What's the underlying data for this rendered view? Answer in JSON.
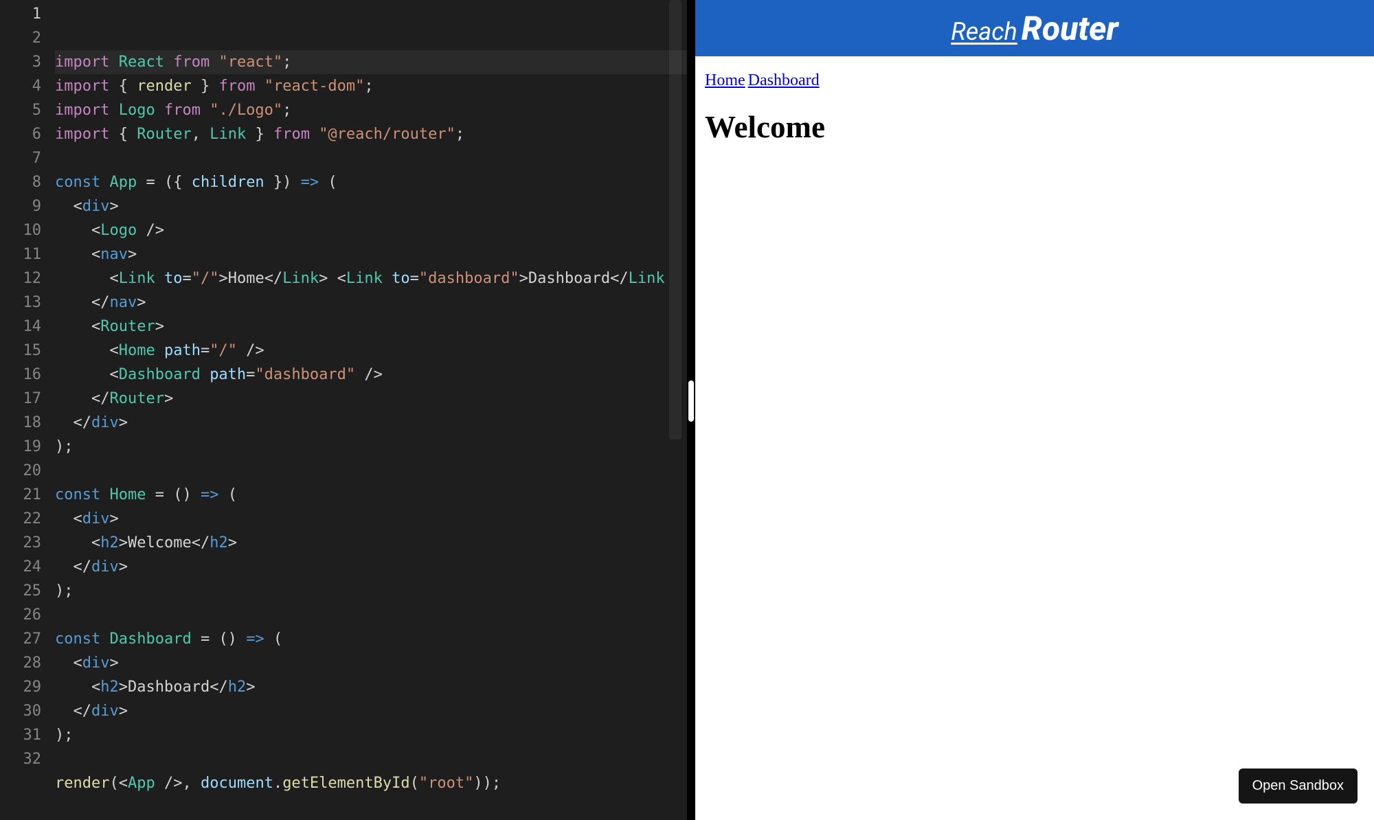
{
  "editor": {
    "line_count": 32,
    "current_line": 1,
    "lines": [
      {
        "n": 1,
        "tokens": [
          [
            "k",
            "import"
          ],
          [
            "punc",
            " "
          ],
          [
            "cls",
            "React"
          ],
          [
            "punc",
            " "
          ],
          [
            "k",
            "from"
          ],
          [
            "punc",
            " "
          ],
          [
            "str",
            "\"react\""
          ],
          [
            "punc",
            ";"
          ]
        ]
      },
      {
        "n": 2,
        "tokens": [
          [
            "k",
            "import"
          ],
          [
            "punc",
            " { "
          ],
          [
            "fn",
            "render"
          ],
          [
            "punc",
            " } "
          ],
          [
            "k",
            "from"
          ],
          [
            "punc",
            " "
          ],
          [
            "str",
            "\"react-dom\""
          ],
          [
            "punc",
            ";"
          ]
        ]
      },
      {
        "n": 3,
        "tokens": [
          [
            "k",
            "import"
          ],
          [
            "punc",
            " "
          ],
          [
            "cls",
            "Logo"
          ],
          [
            "punc",
            " "
          ],
          [
            "k",
            "from"
          ],
          [
            "punc",
            " "
          ],
          [
            "str",
            "\"./Logo\""
          ],
          [
            "punc",
            ";"
          ]
        ]
      },
      {
        "n": 4,
        "tokens": [
          [
            "k",
            "import"
          ],
          [
            "punc",
            " { "
          ],
          [
            "cls",
            "Router"
          ],
          [
            "punc",
            ", "
          ],
          [
            "cls",
            "Link"
          ],
          [
            "punc",
            " } "
          ],
          [
            "k",
            "from"
          ],
          [
            "punc",
            " "
          ],
          [
            "str",
            "\"@reach/router\""
          ],
          [
            "punc",
            ";"
          ]
        ]
      },
      {
        "n": 5,
        "tokens": []
      },
      {
        "n": 6,
        "tokens": [
          [
            "tag",
            "const"
          ],
          [
            "punc",
            " "
          ],
          [
            "cls",
            "App"
          ],
          [
            "punc",
            " = ({ "
          ],
          [
            "var",
            "children"
          ],
          [
            "punc",
            " }) "
          ],
          [
            "tag",
            "=>"
          ],
          [
            "punc",
            " ("
          ]
        ]
      },
      {
        "n": 7,
        "tokens": [
          [
            "punc",
            "  <"
          ],
          [
            "tag",
            "div"
          ],
          [
            "punc",
            ">"
          ]
        ]
      },
      {
        "n": 8,
        "tokens": [
          [
            "punc",
            "    <"
          ],
          [
            "cls",
            "Logo"
          ],
          [
            "punc",
            " />"
          ]
        ]
      },
      {
        "n": 9,
        "tokens": [
          [
            "punc",
            "    <"
          ],
          [
            "tag",
            "nav"
          ],
          [
            "punc",
            ">"
          ]
        ]
      },
      {
        "n": 10,
        "tokens": [
          [
            "punc",
            "      <"
          ],
          [
            "cls",
            "Link"
          ],
          [
            "punc",
            " "
          ],
          [
            "attr",
            "to"
          ],
          [
            "punc",
            "="
          ],
          [
            "str",
            "\"/\""
          ],
          [
            "punc",
            ">"
          ],
          [
            "punc",
            "Home"
          ],
          [
            "punc",
            "</"
          ],
          [
            "cls",
            "Link"
          ],
          [
            "punc",
            "> <"
          ],
          [
            "cls",
            "Link"
          ],
          [
            "punc",
            " "
          ],
          [
            "attr",
            "to"
          ],
          [
            "punc",
            "="
          ],
          [
            "str",
            "\"dashboard\""
          ],
          [
            "punc",
            ">"
          ],
          [
            "punc",
            "Dashboard"
          ],
          [
            "punc",
            "</"
          ],
          [
            "cls",
            "Link"
          ]
        ]
      },
      {
        "n": 11,
        "tokens": [
          [
            "punc",
            "    </"
          ],
          [
            "tag",
            "nav"
          ],
          [
            "punc",
            ">"
          ]
        ]
      },
      {
        "n": 12,
        "tokens": [
          [
            "punc",
            "    <"
          ],
          [
            "cls",
            "Router"
          ],
          [
            "punc",
            ">"
          ]
        ]
      },
      {
        "n": 13,
        "tokens": [
          [
            "punc",
            "      <"
          ],
          [
            "cls",
            "Home"
          ],
          [
            "punc",
            " "
          ],
          [
            "attr",
            "path"
          ],
          [
            "punc",
            "="
          ],
          [
            "str",
            "\"/\""
          ],
          [
            "punc",
            " />"
          ]
        ]
      },
      {
        "n": 14,
        "tokens": [
          [
            "punc",
            "      <"
          ],
          [
            "cls",
            "Dashboard"
          ],
          [
            "punc",
            " "
          ],
          [
            "attr",
            "path"
          ],
          [
            "punc",
            "="
          ],
          [
            "str",
            "\"dashboard\""
          ],
          [
            "punc",
            " />"
          ]
        ]
      },
      {
        "n": 15,
        "tokens": [
          [
            "punc",
            "    </"
          ],
          [
            "cls",
            "Router"
          ],
          [
            "punc",
            ">"
          ]
        ]
      },
      {
        "n": 16,
        "tokens": [
          [
            "punc",
            "  </"
          ],
          [
            "tag",
            "div"
          ],
          [
            "punc",
            ">"
          ]
        ]
      },
      {
        "n": 17,
        "tokens": [
          [
            "punc",
            ");"
          ]
        ]
      },
      {
        "n": 18,
        "tokens": []
      },
      {
        "n": 19,
        "tokens": [
          [
            "tag",
            "const"
          ],
          [
            "punc",
            " "
          ],
          [
            "cls",
            "Home"
          ],
          [
            "punc",
            " = () "
          ],
          [
            "tag",
            "=>"
          ],
          [
            "punc",
            " ("
          ]
        ]
      },
      {
        "n": 20,
        "tokens": [
          [
            "punc",
            "  <"
          ],
          [
            "tag",
            "div"
          ],
          [
            "punc",
            ">"
          ]
        ]
      },
      {
        "n": 21,
        "tokens": [
          [
            "punc",
            "    <"
          ],
          [
            "tag",
            "h2"
          ],
          [
            "punc",
            ">"
          ],
          [
            "punc",
            "Welcome"
          ],
          [
            "punc",
            "</"
          ],
          [
            "tag",
            "h2"
          ],
          [
            "punc",
            ">"
          ]
        ]
      },
      {
        "n": 22,
        "tokens": [
          [
            "punc",
            "  </"
          ],
          [
            "tag",
            "div"
          ],
          [
            "punc",
            ">"
          ]
        ]
      },
      {
        "n": 23,
        "tokens": [
          [
            "punc",
            ");"
          ]
        ]
      },
      {
        "n": 24,
        "tokens": []
      },
      {
        "n": 25,
        "tokens": [
          [
            "tag",
            "const"
          ],
          [
            "punc",
            " "
          ],
          [
            "cls",
            "Dashboard"
          ],
          [
            "punc",
            " = () "
          ],
          [
            "tag",
            "=>"
          ],
          [
            "punc",
            " ("
          ]
        ]
      },
      {
        "n": 26,
        "tokens": [
          [
            "punc",
            "  <"
          ],
          [
            "tag",
            "div"
          ],
          [
            "punc",
            ">"
          ]
        ]
      },
      {
        "n": 27,
        "tokens": [
          [
            "punc",
            "    <"
          ],
          [
            "tag",
            "h2"
          ],
          [
            "punc",
            ">"
          ],
          [
            "punc",
            "Dashboard"
          ],
          [
            "punc",
            "</"
          ],
          [
            "tag",
            "h2"
          ],
          [
            "punc",
            ">"
          ]
        ]
      },
      {
        "n": 28,
        "tokens": [
          [
            "punc",
            "  </"
          ],
          [
            "tag",
            "div"
          ],
          [
            "punc",
            ">"
          ]
        ]
      },
      {
        "n": 29,
        "tokens": [
          [
            "punc",
            ");"
          ]
        ]
      },
      {
        "n": 30,
        "tokens": []
      },
      {
        "n": 31,
        "tokens": [
          [
            "fn",
            "render"
          ],
          [
            "punc",
            "(<"
          ],
          [
            "cls",
            "App"
          ],
          [
            "punc",
            " />, "
          ],
          [
            "var",
            "document"
          ],
          [
            "punc",
            "."
          ],
          [
            "fn",
            "getElementById"
          ],
          [
            "punc",
            "("
          ],
          [
            "str",
            "\"root\""
          ],
          [
            "punc",
            "));"
          ]
        ]
      },
      {
        "n": 32,
        "tokens": []
      }
    ]
  },
  "preview": {
    "logo": {
      "reach": "Reach",
      "router": "Router"
    },
    "nav": {
      "home": "Home",
      "dashboard": "Dashboard"
    },
    "heading": "Welcome"
  },
  "open_sandbox_label": "Open Sandbox"
}
